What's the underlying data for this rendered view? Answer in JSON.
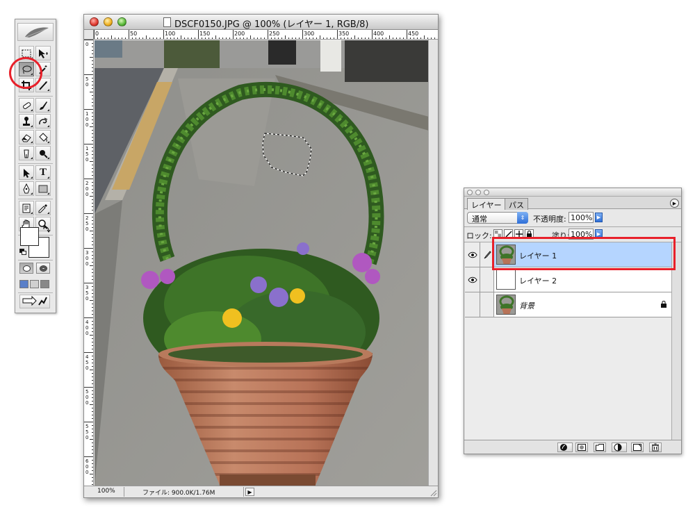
{
  "toolbox": {
    "tools": [
      {
        "name": "rect-marquee-tool"
      },
      {
        "name": "move-tool"
      },
      {
        "name": "lasso-tool",
        "selected": true
      },
      {
        "name": "magic-wand-tool"
      },
      {
        "name": "crop-tool"
      },
      {
        "name": "slice-tool"
      },
      {
        "name": "healing-brush-tool"
      },
      {
        "name": "brush-tool"
      },
      {
        "name": "clone-stamp-tool"
      },
      {
        "name": "history-brush-tool"
      },
      {
        "name": "eraser-tool"
      },
      {
        "name": "paint-bucket-tool"
      },
      {
        "name": "blur-tool"
      },
      {
        "name": "dodge-tool"
      },
      {
        "name": "path-selection-tool"
      },
      {
        "name": "type-tool"
      },
      {
        "name": "pen-tool"
      },
      {
        "name": "shape-tool"
      },
      {
        "name": "notes-tool"
      },
      {
        "name": "eyedropper-tool"
      },
      {
        "name": "hand-tool"
      },
      {
        "name": "zoom-tool"
      }
    ],
    "type_tool_glyph": "T",
    "highlight_color": "#e8202a"
  },
  "document": {
    "title": "DSCF0150.JPG @ 100% (レイヤー 1, RGB/8)",
    "zoom": "100%",
    "file_info": "ファイル: 900.0K/1.76M",
    "ruler_h_labels": [
      "0",
      "50",
      "100",
      "150",
      "200",
      "250",
      "300",
      "350",
      "400",
      "450"
    ],
    "ruler_v_labels": [
      "0",
      "5\n0",
      "1\n0\n0",
      "1\n5\n0",
      "2\n0\n0",
      "2\n5\n0",
      "3\n0\n0",
      "3\n5\n0",
      "4\n0\n0",
      "4\n5\n0",
      "5\n0\n0",
      "5\n5\n0",
      "6\n0\n0"
    ]
  },
  "layers_panel": {
    "tabs": [
      "レイヤー",
      "パス"
    ],
    "blend_mode": "通常",
    "opacity_label": "不透明度:",
    "opacity_value": "100%",
    "lock_label": "ロック:",
    "fill_label": "塗り:",
    "fill_value": "100%",
    "layers": [
      {
        "name": "レイヤー 1",
        "visible": true,
        "selected": true,
        "thumbnail": "photo",
        "locked": false
      },
      {
        "name": "レイヤー 2",
        "visible": true,
        "selected": false,
        "thumbnail": "blank",
        "locked": false
      },
      {
        "name": "背景",
        "visible": false,
        "selected": false,
        "thumbnail": "photo",
        "locked": true
      }
    ],
    "highlight_color": "#e8202a",
    "selected_row_color": "#b5d5ff"
  }
}
